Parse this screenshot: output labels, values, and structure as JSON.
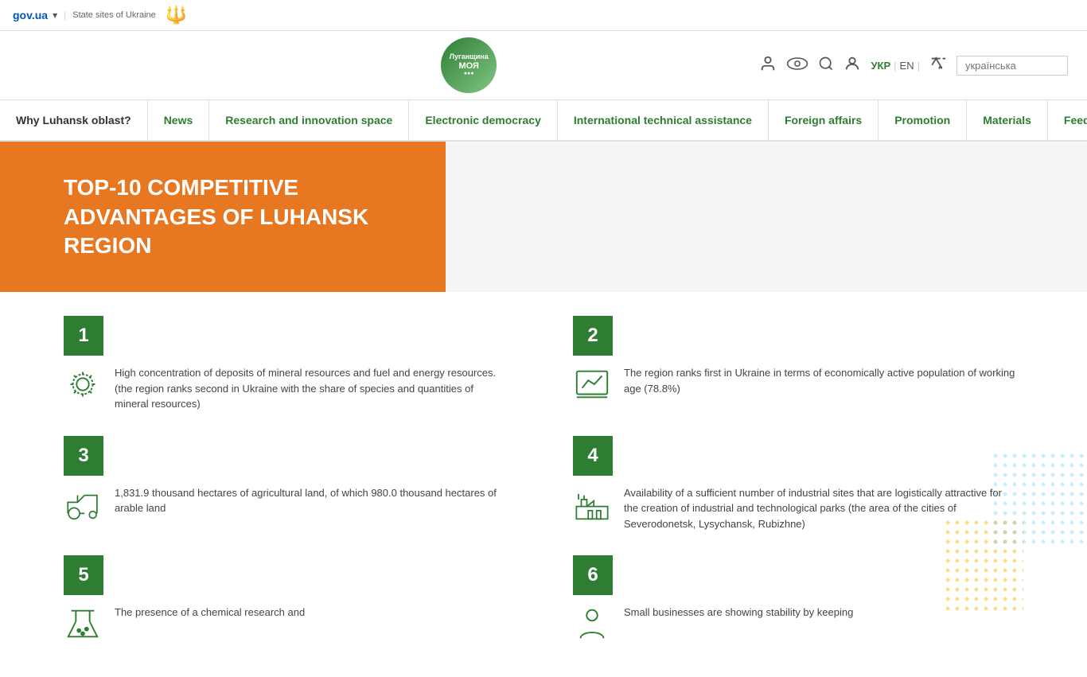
{
  "topbar": {
    "gov_label": "gov.ua",
    "gov_arrow": "▾",
    "state_sites": "State sites of Ukraine",
    "trident": "𝌆"
  },
  "header": {
    "logo_line1": "Луганщина",
    "logo_line2": "МОЯ",
    "search_placeholder": "українська"
  },
  "lang": {
    "ukr": "УКР",
    "en": "EN",
    "separator": "|"
  },
  "nav": {
    "items": [
      {
        "id": "why-luhansk",
        "label": "Why Luhansk oblast?"
      },
      {
        "id": "news",
        "label": "News"
      },
      {
        "id": "research",
        "label": "Research and innovation space"
      },
      {
        "id": "electronic",
        "label": "Electronic democracy"
      },
      {
        "id": "international",
        "label": "International technical assistance"
      },
      {
        "id": "foreign",
        "label": "Foreign affairs"
      },
      {
        "id": "promotion",
        "label": "Promotion"
      },
      {
        "id": "materials",
        "label": "Materials"
      },
      {
        "id": "feedback",
        "label": "Feedback"
      }
    ]
  },
  "hero": {
    "title": "TOP-10 COMPETITIVE ADVANTAGES OF LUHANSK REGION"
  },
  "advantages": [
    {
      "number": "1",
      "icon_type": "gear",
      "text": "High concentration of deposits of mineral resources and fuel and energy resources. (the region ranks second in Ukraine with the share of species and quantities of mineral resources)"
    },
    {
      "number": "2",
      "icon_type": "chart",
      "text": "The region ranks first in Ukraine in terms of economically active population of working age (78.8%)"
    },
    {
      "number": "3",
      "icon_type": "tractor",
      "text": "1,831.9 thousand hectares of agricultural land, of which 980.0 thousand hectares of arable land"
    },
    {
      "number": "4",
      "icon_type": "factory",
      "text": "Availability of a sufficient number of industrial sites that are logistically attractive for the creation of industrial and technological parks (the area of the cities of Severodonetsk, Lysychansk, Rubizhne)"
    },
    {
      "number": "5",
      "icon_type": "chemistry",
      "text": "The presence of a chemical research and"
    },
    {
      "number": "6",
      "icon_type": "person",
      "text": "Small businesses are showing stability by keeping"
    }
  ]
}
